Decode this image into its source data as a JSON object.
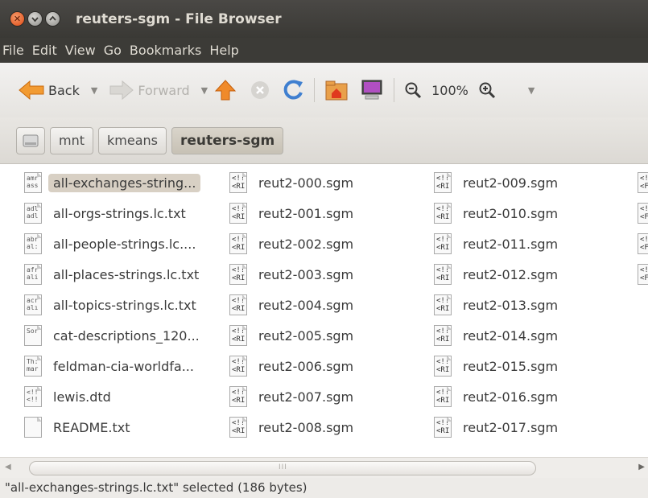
{
  "window": {
    "title": "reuters-sgm - File Browser"
  },
  "menubar": [
    "File",
    "Edit",
    "View",
    "Go",
    "Bookmarks",
    "Help"
  ],
  "toolbar": {
    "back_label": "Back",
    "forward_label": "Forward",
    "zoom_value": "100%"
  },
  "breadcrumb": {
    "items": [
      "mnt",
      "kmeans",
      "reuters-sgm"
    ]
  },
  "files": {
    "columns": [
      [
        {
          "name": "all-exchanges-string...",
          "icon": "amr ass",
          "selected": true
        },
        {
          "name": "all-orgs-strings.lc.txt",
          "icon": "adl adl"
        },
        {
          "name": "all-people-strings.lc....",
          "icon": "abr al:"
        },
        {
          "name": "all-places-strings.lc.txt",
          "icon": "afr ali"
        },
        {
          "name": "all-topics-strings.lc.txt",
          "icon": "acr alı"
        },
        {
          "name": "cat-descriptions_120...",
          "icon": "Sor"
        },
        {
          "name": "feldman-cia-worldfa...",
          "icon": "Th: mar"
        },
        {
          "name": "lewis.dtd",
          "icon": "<!! <!!"
        },
        {
          "name": "README.txt",
          "icon": ""
        }
      ],
      [
        {
          "name": "reut2-000.sgm",
          "icon": "<!! <RI"
        },
        {
          "name": "reut2-001.sgm",
          "icon": "<!! <RI"
        },
        {
          "name": "reut2-002.sgm",
          "icon": "<!! <RI"
        },
        {
          "name": "reut2-003.sgm",
          "icon": "<!! <RI"
        },
        {
          "name": "reut2-004.sgm",
          "icon": "<!! <RI"
        },
        {
          "name": "reut2-005.sgm",
          "icon": "<!! <RI"
        },
        {
          "name": "reut2-006.sgm",
          "icon": "<!! <RI"
        },
        {
          "name": "reut2-007.sgm",
          "icon": "<!! <RI"
        },
        {
          "name": "reut2-008.sgm",
          "icon": "<!! <RI"
        }
      ],
      [
        {
          "name": "reut2-009.sgm",
          "icon": "<!! <RI"
        },
        {
          "name": "reut2-010.sgm",
          "icon": "<!! <RI"
        },
        {
          "name": "reut2-011.sgm",
          "icon": "<!! <RI"
        },
        {
          "name": "reut2-012.sgm",
          "icon": "<!! <RI"
        },
        {
          "name": "reut2-013.sgm",
          "icon": "<!! <RI"
        },
        {
          "name": "reut2-014.sgm",
          "icon": "<!! <RI"
        },
        {
          "name": "reut2-015.sgm",
          "icon": "<!! <RI"
        },
        {
          "name": "reut2-016.sgm",
          "icon": "<!! <RI"
        },
        {
          "name": "reut2-017.sgm",
          "icon": "<!! <RI"
        }
      ],
      [
        {
          "name": "",
          "icon": "<! <F"
        },
        {
          "name": "",
          "icon": "<! <F"
        },
        {
          "name": "",
          "icon": "<! <F"
        },
        {
          "name": "",
          "icon": "<! <F"
        }
      ]
    ]
  },
  "scrollbar": {
    "grip": "III"
  },
  "status": {
    "text": "\"all-exchanges-strings.lc.txt\" selected (186 bytes)"
  }
}
